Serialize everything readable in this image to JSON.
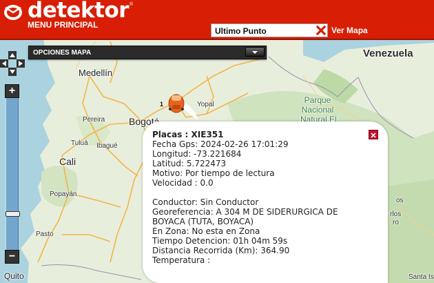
{
  "header": {
    "brand": "detektor",
    "menu_title": "MENU PRINCIPAL",
    "ultimo_punto_label": "Ultimo Punto",
    "ver_mapa_label": "Ver Mapa"
  },
  "map_options": {
    "label": "OPCIONES MAPA"
  },
  "map_labels": {
    "venezuela": "Venezuela",
    "medellin": "Medellín",
    "bogota": "Bogotá",
    "cali": "Cali",
    "yopal": "Yopal",
    "parque": "Parque",
    "nacional": "Nacional",
    "natural": "Natural El",
    "pereira": "Pereira",
    "tulua": "Tuluá",
    "ibague": "Ibagué",
    "popayan": "Popayán",
    "pasto": "Pasto",
    "quito": "Quito",
    "los": "os",
    "ferenzo": "",
    "rlos": "rlos",
    "ro": "ro",
    "santa": "Santa Is"
  },
  "vehicle": {
    "number": "1",
    "marker_color": "#e8621c"
  },
  "info": {
    "placas_label": "Placas :",
    "placas_value": "XIE351",
    "fecha": "Fecha Gps: 2024-02-26 17:01:29",
    "longitud": "Longitud: -73.221684",
    "latitud": "Latitud: 5.722473",
    "motivo": "Motivo: Por tiempo de lectura",
    "velocidad": "Velocidad : 0.0",
    "conductor": "Conductor: Sin Conductor",
    "georeferencia": "Georeferencia: A 304 M DE SIDERURGICA DE BOYACA (TUTA, BOYACA)",
    "en_zona": "En Zona: No esta en Zona",
    "tiempo": "Tiempo Detencion: 01h 04m 59s",
    "distancia": "Distancia Recorrida (Km): 364.90",
    "temperatura": "Temperatura :"
  },
  "colors": {
    "brand_red": "#d81e05",
    "land": "#e9efdc",
    "forest": "#c8dfba",
    "water": "#aad3df",
    "road": "#f6b84c"
  }
}
